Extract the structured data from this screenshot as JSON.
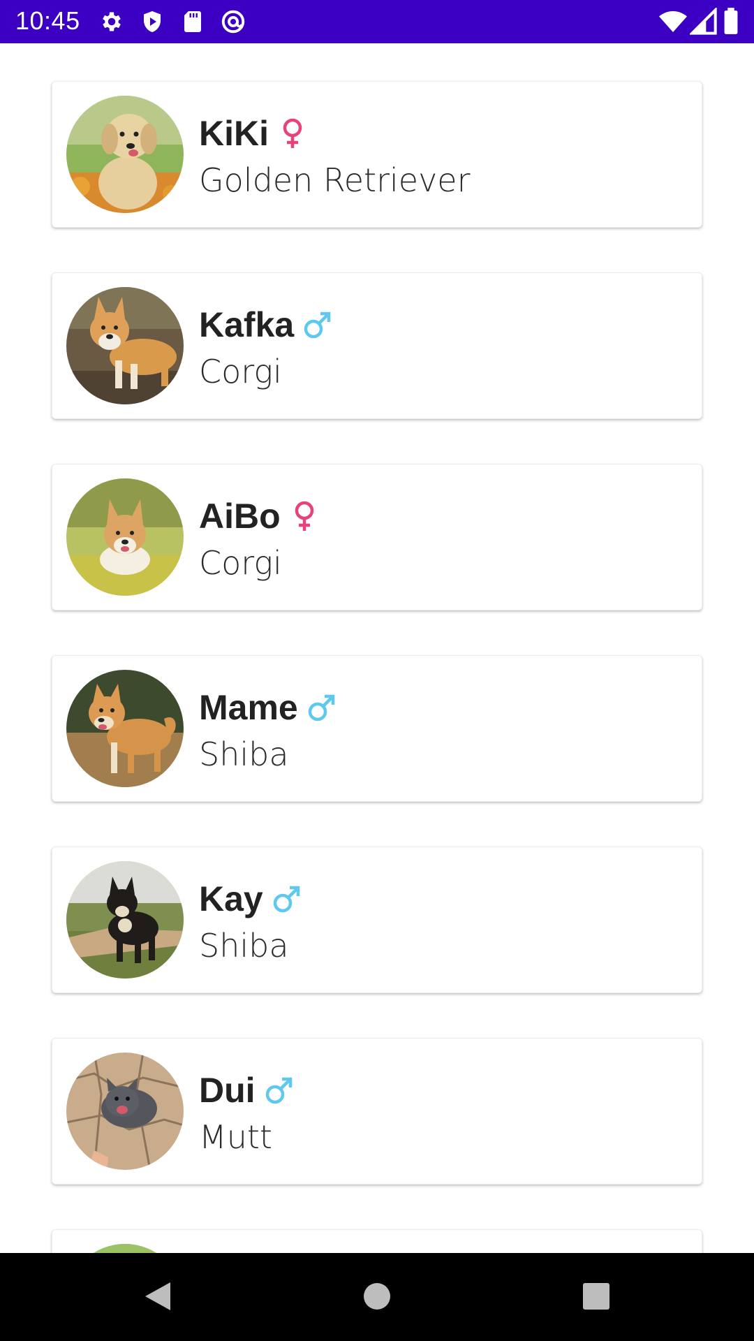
{
  "status_bar": {
    "time": "10:45",
    "left_icons": [
      "gear-icon",
      "shield-play-icon",
      "sd-card-icon",
      "at-sign-icon"
    ],
    "right_icons": [
      "wifi-icon",
      "cell-signal-icon",
      "battery-icon"
    ],
    "background_color": "#3b00c2"
  },
  "pets": [
    {
      "name": "KiKi",
      "gender": "female",
      "breed": "Golden Retriever"
    },
    {
      "name": "Kafka",
      "gender": "male",
      "breed": "Corgi"
    },
    {
      "name": "AiBo",
      "gender": "female",
      "breed": "Corgi"
    },
    {
      "name": "Mame",
      "gender": "male",
      "breed": "Shiba"
    },
    {
      "name": "Kay",
      "gender": "male",
      "breed": "Shiba"
    },
    {
      "name": "Dui",
      "gender": "male",
      "breed": "Mutt"
    }
  ],
  "colors": {
    "female": "#e8427c",
    "male": "#5ec8ee"
  },
  "nav_bar": {
    "buttons": [
      "back-icon",
      "home-icon",
      "recents-icon"
    ]
  }
}
